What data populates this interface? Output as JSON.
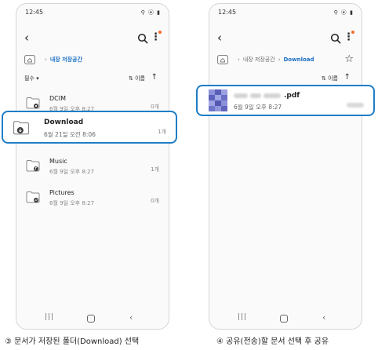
{
  "status_bar": {
    "time": "12:45",
    "icons": "⚲ ⦿ ▮"
  },
  "left_screen": {
    "breadcrumb": [
      "내장 저장공간"
    ],
    "sort": {
      "filter_label": "필수 ▾",
      "field_label": "이름",
      "direction": "↑"
    },
    "folders": [
      {
        "name": "DCIM",
        "date": "6월 9일 오후 8:27",
        "count": "0개",
        "badge": "camera"
      },
      {
        "name": "Download",
        "date": "6월 21일 오전 8:06",
        "count": "1개",
        "badge": "download",
        "highlighted": true
      },
      {
        "name": "Music",
        "date": "6월 9일 오후 8:27",
        "count": "1개",
        "badge": "music"
      },
      {
        "name": "Pictures",
        "date": "6월 9일 오후 8:27",
        "count": "0개",
        "badge": "image"
      }
    ]
  },
  "right_screen": {
    "breadcrumb": [
      "내장 저장공간",
      "Download"
    ],
    "sort": {
      "field_label": "이름",
      "direction": "↑"
    },
    "file": {
      "name_visible_part": ".pdf",
      "date": "6월 9일 오후 8:27"
    }
  },
  "icons": {
    "back": "‹",
    "more": "⋮",
    "star": "☆",
    "sort": "⇅",
    "nav_recents": "|||",
    "nav_back": "‹",
    "crumb_sep": "›"
  },
  "captions": {
    "left": "③ 문서가 저장된 폴더(Download) 선택",
    "right": "④ 공유(전송)할 문서 선택 후 공유"
  },
  "colors": {
    "accent": "#1f7ec7",
    "notify_dot": "#f06a2b"
  }
}
